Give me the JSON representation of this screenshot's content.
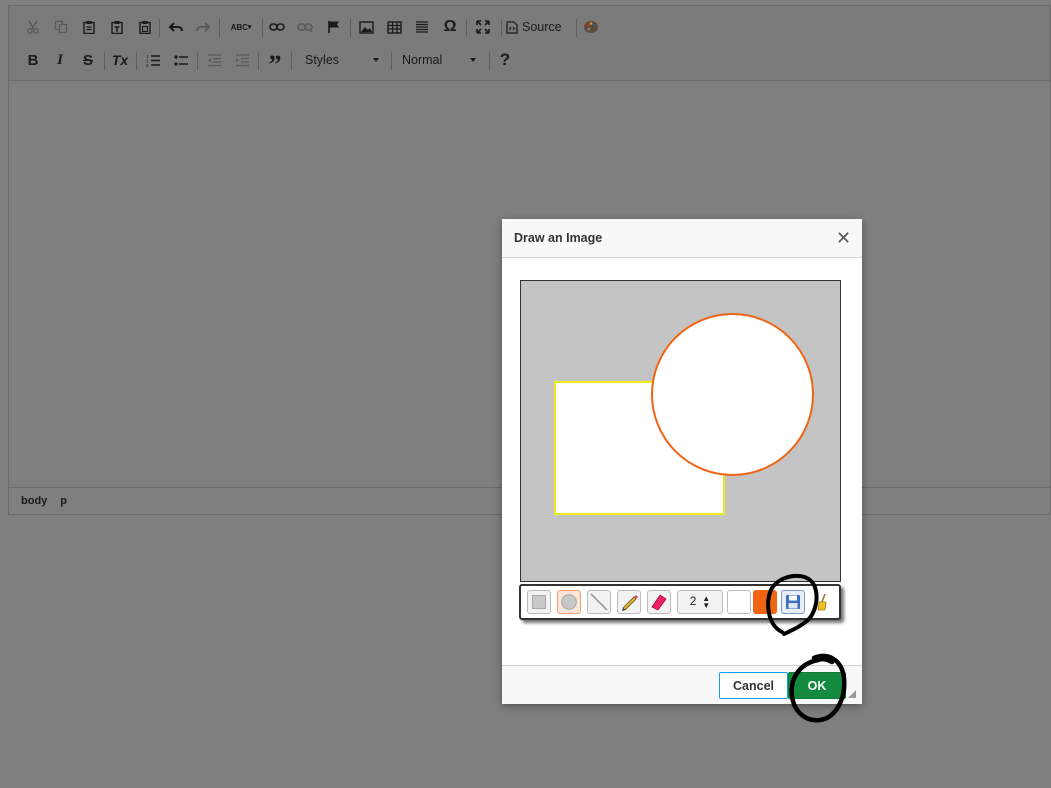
{
  "toolbar": {
    "source_label": "Source",
    "styles_combo": "Styles",
    "format_combo": "Normal",
    "help_label": "?",
    "bold_label": "B",
    "italic_label": "I",
    "strike_label": "S",
    "removeformat_label": "Tx",
    "blockquote_label": "”",
    "specialchar_label": "Ω",
    "spellcheck_label": "ABC"
  },
  "statusbar": {
    "path": [
      "body",
      "p"
    ]
  },
  "dialog": {
    "title": "Draw an Image",
    "close_label": "✕",
    "cancel_label": "Cancel",
    "ok_label": "OK"
  },
  "draw_tools": {
    "line_width": "2",
    "fill_color": "#ffffff",
    "stroke_color": "#f06414",
    "active_tool": "circle"
  },
  "canvas": {
    "background_color": "#c4c4c4",
    "shapes": [
      {
        "type": "rectangle",
        "fill": "#ffffff",
        "stroke": "#f0ea1c"
      },
      {
        "type": "circle",
        "fill": "#ffffff",
        "stroke": "#f06414"
      }
    ]
  }
}
